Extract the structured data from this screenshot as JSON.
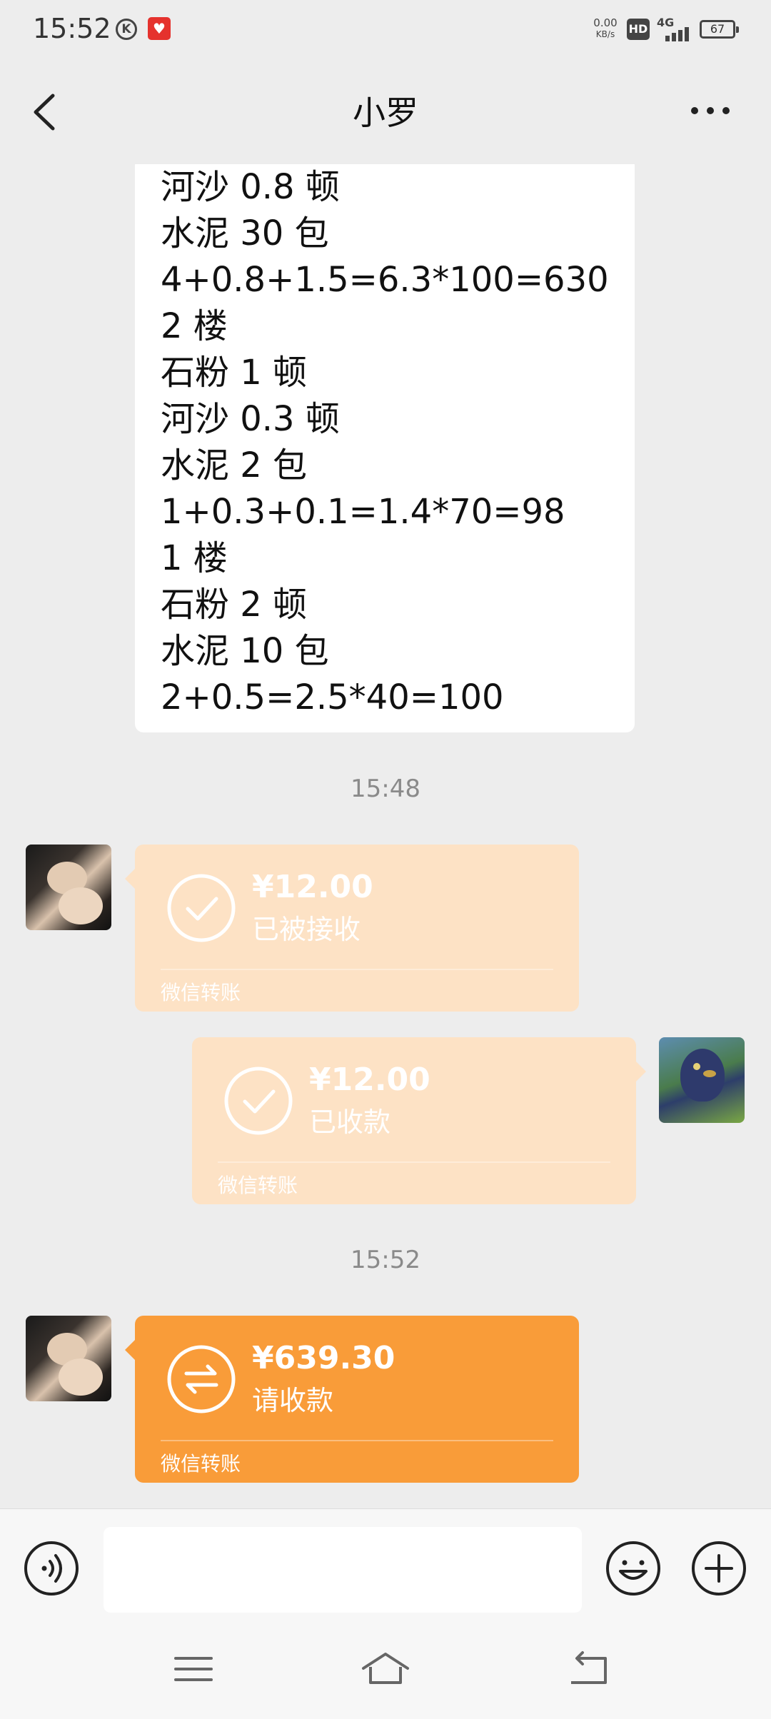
{
  "status_bar": {
    "time": "15:52",
    "net_speed_value": "0.00",
    "net_speed_unit": "KB/s",
    "hd": "HD",
    "network_type": "4G",
    "battery": "67",
    "k_icon_letter": "K"
  },
  "header": {
    "title": "小罗"
  },
  "message_text": {
    "lines": [
      "河沙 0.8 顿",
      "水泥 30 包",
      "4+0.8+1.5=6.3*100=630",
      "2 楼",
      "石粉 1 顿",
      "河沙 0.3 顿",
      "水泥 2 包",
      "1+0.3+0.1=1.4*70=98",
      "1 楼",
      "石粉 2 顿",
      "水泥 10 包",
      "2+0.5=2.5*40=100"
    ]
  },
  "timestamps": [
    "15:48",
    "15:52"
  ],
  "transfers": [
    {
      "amount": "¥12.00",
      "status": "已被接收",
      "brand": "微信转账"
    },
    {
      "amount": "¥12.00",
      "status": "已收款",
      "brand": "微信转账"
    },
    {
      "amount": "¥639.30",
      "status": "请收款",
      "brand": "微信转账"
    }
  ],
  "colors": {
    "background": "#ededed",
    "transfer_pale": "#fde2c5",
    "transfer_active": "#f99c39"
  },
  "icons": {
    "back": "chevron-left-icon",
    "more": "more-dots-icon",
    "transfer_received": "check-circle-icon",
    "transfer_request": "exchange-arrows-icon",
    "voice": "voice-icon",
    "emoji": "emoji-icon",
    "plus": "plus-circle-icon",
    "menu": "menu-icon",
    "home": "home-icon",
    "return": "return-icon"
  }
}
